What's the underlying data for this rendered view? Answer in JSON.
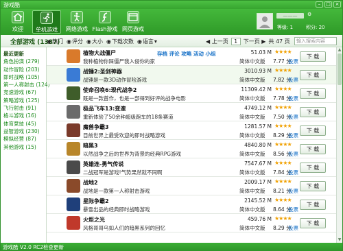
{
  "window": {
    "title": "游戏酷"
  },
  "nav": [
    {
      "label": "欢迎"
    },
    {
      "label": "单机游戏"
    },
    {
      "label": "网络游戏"
    },
    {
      "label": "Flash游戏"
    },
    {
      "label": "网页游戏"
    }
  ],
  "user": {
    "name": "一一一",
    "level": "等级: 1",
    "points": "积分: 20"
  },
  "section_title": "全部游戏 (1387)",
  "filters": {
    "hot": "热门",
    "score": "评分",
    "size": "大小",
    "downloads": "下载次数",
    "language": "语言"
  },
  "pager": {
    "prev": "上一页",
    "page": "1",
    "next": "下一页",
    "total": "共 47 页",
    "search_placeholder": "输入搜索内容"
  },
  "sidebar": [
    {
      "label": "最近更新"
    },
    {
      "label": "角色扮演 (279)"
    },
    {
      "label": "动作冒险 (203)"
    },
    {
      "label": "即时战略 (105)"
    },
    {
      "label": "第一人称射击 (124)"
    },
    {
      "label": "竞速游戏 (67)"
    },
    {
      "label": "策略游戏 (125)"
    },
    {
      "label": "飞行射击 (91)"
    },
    {
      "label": "格斗游戏 (16)"
    },
    {
      "label": "体育竞技 (45)"
    },
    {
      "label": "益智游戏 (230)"
    },
    {
      "label": "模拟经营 (87)"
    },
    {
      "label": "其他游戏 (15)"
    }
  ],
  "row_actions": "存档 评论 攻略 活动 小组",
  "games": [
    {
      "name": "植物大战僵尸",
      "desc": "我种植物你踩僵尸我入侵你的家",
      "size": "51.03 M",
      "lang": "简体中文版",
      "stars": "★★★★",
      "score": "7.77 分",
      "vote": "投票",
      "dl": "下 载",
      "color": "#d97a2b"
    },
    {
      "name": "战锤2:圣剑神器",
      "desc": "战锤是一款3D动作冒险游戏",
      "size": "3010.93 M",
      "lang": "简体中文版",
      "stars": "★★★★",
      "score": "7.82 分",
      "vote": "投票",
      "dl": "下 载",
      "color": "#3a7bd5"
    },
    {
      "name": "使命召唤6:现代战争2",
      "desc": "既是一款首作，也是一部得到好评的战争电影",
      "size": "11309.42 M",
      "lang": "简体中文版",
      "stars": "★★★★",
      "score": "7.78 分",
      "vote": "投票",
      "dl": "下 载",
      "color": "#3f5d2a"
    },
    {
      "name": "极品飞车13:变速",
      "desc": "重新体验了50余种超级跑车的18条赛道",
      "size": "4749.12 M",
      "lang": "简体中文版",
      "stars": "★★★★",
      "score": "7.50 分",
      "vote": "投票",
      "dl": "下 载",
      "color": "#6b6b6b"
    },
    {
      "name": "魔兽争霸3",
      "desc": "目前世界上最受欢迎的即时战略游戏",
      "size": "1281.57 M",
      "lang": "简体中文版",
      "stars": "★★★★",
      "score": "8.29 分",
      "vote": "投票",
      "dl": "下 载",
      "color": "#7a3a2a"
    },
    {
      "name": "暗黑3",
      "desc": "以然战争之后的世界为背景的经典RPG游戏",
      "size": "4840.80 M",
      "lang": "简体中文版",
      "stars": "★★★★",
      "score": "8.56 分",
      "vote": "投票",
      "dl": "下 载",
      "color": "#b8862a"
    },
    {
      "name": "英雄连-勇气传说",
      "desc": "二战冠军是游戏!气势果然就不同啊",
      "size": "7547.67 M",
      "lang": "简体中文版",
      "stars": "★★★★",
      "score": "7.84 分",
      "vote": "投票",
      "dl": "下 载",
      "color": "#4a4a4a"
    },
    {
      "name": "战地2",
      "desc": "战地是一款第一人称射击游戏",
      "size": "2009.17 M",
      "lang": "简体中文版",
      "stars": "★★★★",
      "score": "8.21 分",
      "vote": "投票",
      "dl": "下 载",
      "color": "#8a4a2a"
    },
    {
      "name": "星际争霸2",
      "desc": "暴雪出品的经典即时战略游戏",
      "size": "2145.52 M",
      "lang": "简体中文版",
      "stars": "★★★★",
      "score": "8.64 分",
      "vote": "投票",
      "dl": "下 载",
      "color": "#1f3f7a"
    },
    {
      "name": "火炬之光",
      "desc": "风格哥哥乌如人们的暗黑系列的回忆",
      "size": "459.76 M",
      "lang": "简体中文版",
      "stars": "★★★★",
      "score": "8.29 分",
      "vote": "投票",
      "dl": "下 载",
      "color": "#c0392b"
    }
  ],
  "status": {
    "version": "游戏酷 V2.0 RC2",
    "update": "检查更新"
  }
}
